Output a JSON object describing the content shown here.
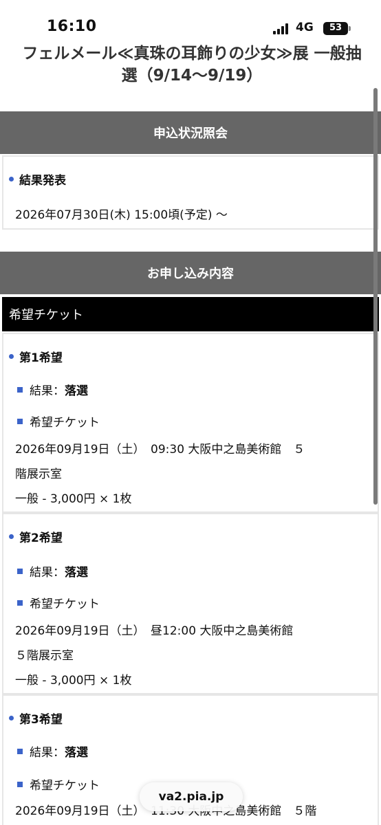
{
  "status": {
    "time": "16:10",
    "network": "4G",
    "battery": "53"
  },
  "title": {
    "line1": "フェルメール≪真珠の耳飾りの少女≫展 一般抽",
    "line2": "選（9/14〜9/19）"
  },
  "inquiry": {
    "header": "申込状況照会",
    "result_label": "結果発表",
    "result_datetime": "2026年07月30日(木) 15:00頃(予定) 〜"
  },
  "application": {
    "header": "お申し込み内容",
    "ticket_bar": "希望チケット",
    "choices": [
      {
        "title": "第1希望",
        "result_prefix": "結果：",
        "result_value": "落選",
        "ticket_label": "希望チケット",
        "line1": "2026年09月19日（土）　09:30  大阪中之島美術館　５",
        "line2": "階展示室",
        "price": "一般 - 3,000円 × 1枚"
      },
      {
        "title": "第2希望",
        "result_prefix": "結果：",
        "result_value": "落選",
        "ticket_label": "希望チケット",
        "line1": "2026年09月19日（土）　昼12:00  大阪中之島美術館",
        "line2": "５階展示室",
        "price": "一般 - 3,000円 × 1枚"
      },
      {
        "title": "第3希望",
        "result_prefix": "結果：",
        "result_value": "落選",
        "ticket_label": "希望チケット",
        "line1": "2026年09月19日（土）　11:30  大阪中之島美術館　５階"
      }
    ]
  },
  "browser": {
    "url": "va2.pia.jp"
  },
  "colors": {
    "header_gray": "#666666",
    "accent_blue": "#3b63c9",
    "bar_black": "#000000"
  }
}
